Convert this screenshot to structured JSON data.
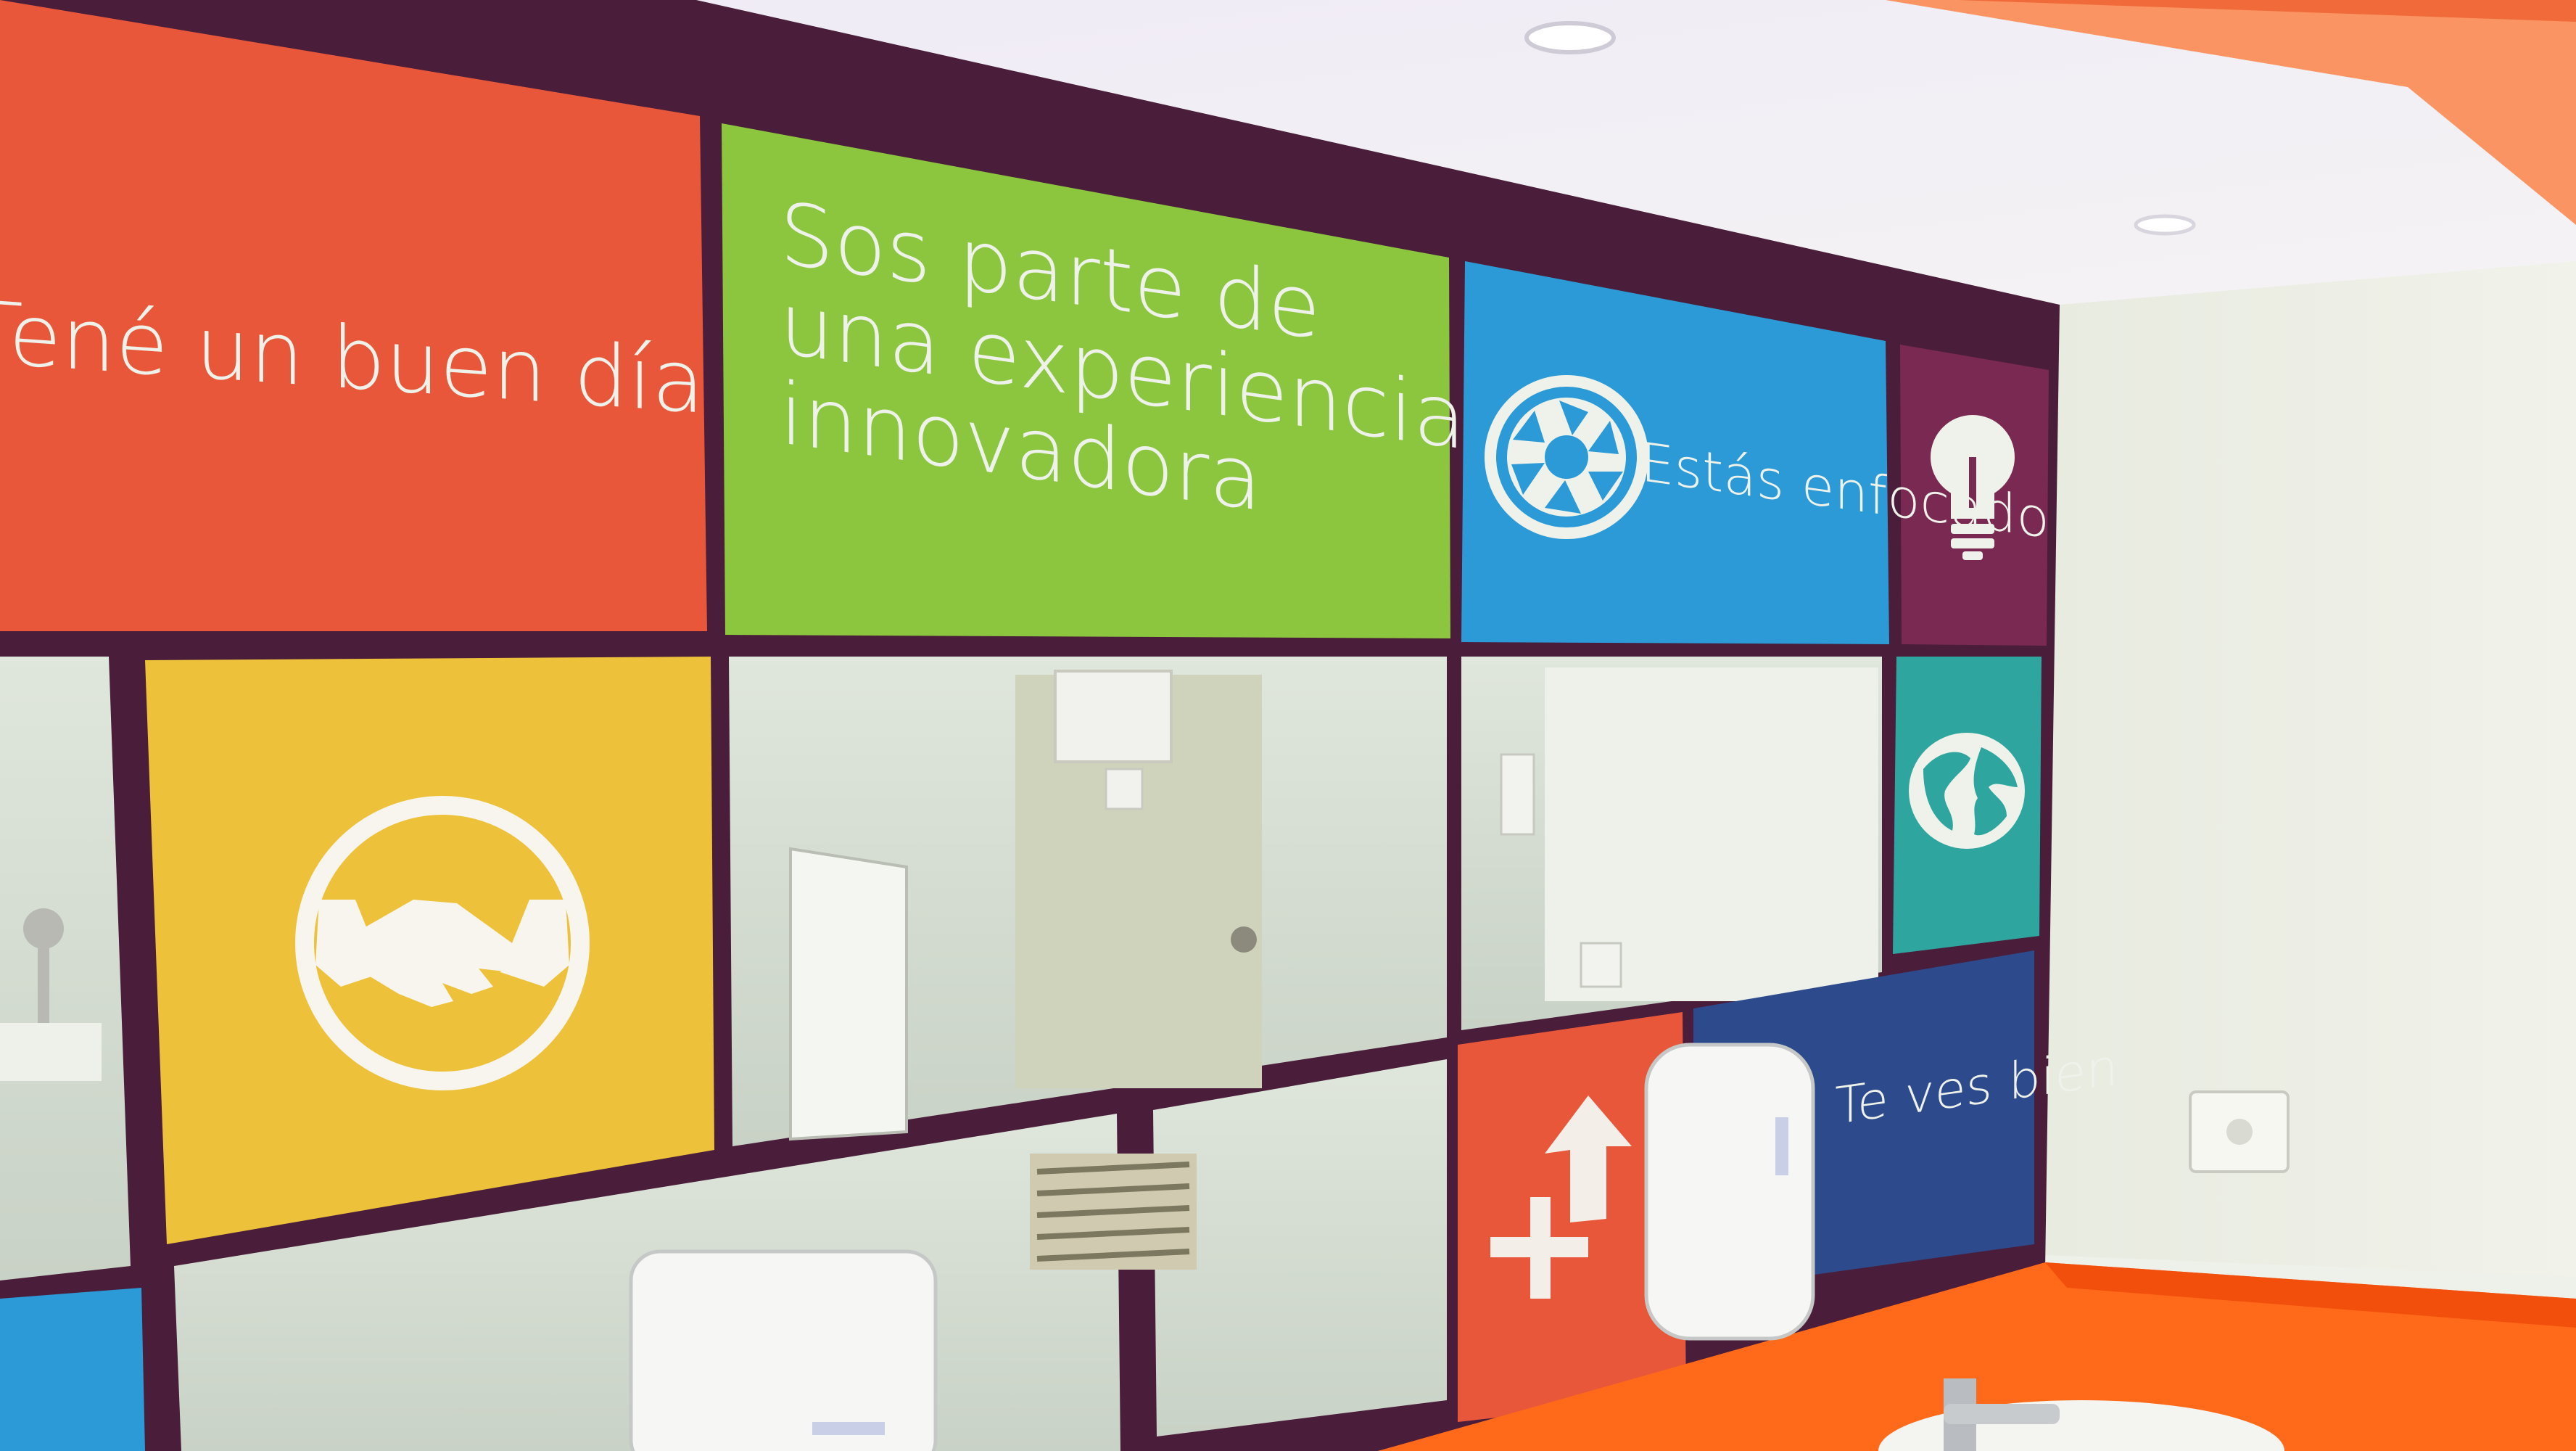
{
  "photo": {
    "subject": "restroom mirror wall with colored tile decals",
    "colors": {
      "frame": "#4a1d3a",
      "orange": "#e8573a",
      "green": "#8cc63e",
      "blue": "#2b9ad6",
      "plum": "#7a2a52",
      "yellow": "#eec13a",
      "teal": "#2fa5a0",
      "navy": "#2d4a8c",
      "counter": "#ff6a1a"
    },
    "tiles": {
      "orange_top": {
        "text": "Tené un buen día"
      },
      "green_top": {
        "lines": [
          "Sos parte de",
          "una experiencia",
          "innovadora"
        ]
      },
      "blue_top": {
        "text": "Estás enfocado",
        "icon": "camera-aperture-icon"
      },
      "plum_top": {
        "icon": "lightbulb-icon"
      },
      "yellow_mid": {
        "icon": "handshake-icon"
      },
      "teal_mid": {
        "icon": "globe-icon"
      },
      "orange_low": {
        "icon": "arrow-up-plus-icon"
      },
      "navy_low": {
        "text": "Te ves bien"
      }
    }
  }
}
